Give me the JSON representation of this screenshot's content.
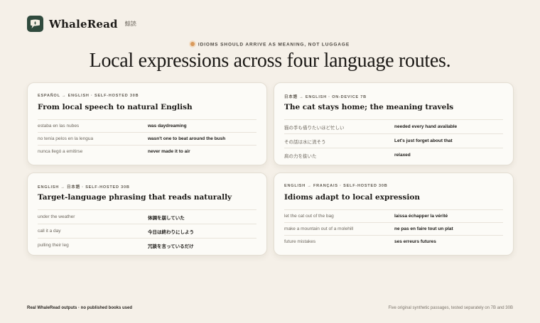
{
  "brand": {
    "name": "WhaleRead",
    "subtitle": "鯨読",
    "logo_icon": "speech-bubble-icon",
    "logo_color": "#2f4a3d"
  },
  "hero": {
    "eyebrow": "IDIOMS SHOULD ARRIVE AS MEANING, NOT LUGGAGE",
    "headline": "Local expressions across four language routes.",
    "accent_color": "#d99a5c"
  },
  "cards": [
    {
      "meta": "ESPAÑOL → ENGLISH · SELF-HOSTED 30B",
      "title": "From local speech to natural English",
      "rows": [
        {
          "source": "estaba en las nubes",
          "target": "was daydreaming"
        },
        {
          "source": "no tenía pelos en la lengua",
          "target": "wasn't one to beat around the bush"
        },
        {
          "source": "nunca llegó a emitirse",
          "target": "never made it to air"
        }
      ]
    },
    {
      "meta": "日本語 → ENGLISH · ON-DEVICE 7B",
      "title": "The cat stays home; the meaning travels",
      "rows": [
        {
          "source": "猫の手も借りたいほど忙しい",
          "target": "needed every hand available"
        },
        {
          "source": "その話は水に流そう",
          "target": "Let's just forget about that"
        },
        {
          "source": "肩の力を抜いた",
          "target": "relaxed"
        }
      ]
    },
    {
      "meta": "ENGLISH → 日本語 · SELF-HOSTED 30B",
      "title": "Target-language phrasing that reads naturally",
      "rows": [
        {
          "source": "under the weather",
          "target": "体調を崩していた"
        },
        {
          "source": "call it a day",
          "target": "今日は終わりにしよう"
        },
        {
          "source": "pulling their leg",
          "target": "冗談を言っているだけ"
        }
      ]
    },
    {
      "meta": "ENGLISH → FRANÇAIS · SELF-HOSTED 30B",
      "title": "Idioms adapt to local expression",
      "rows": [
        {
          "source": "let the cat out of the bag",
          "target": "laissa échapper la vérité"
        },
        {
          "source": "make a mountain out of a molehill",
          "target": "ne pas en faire tout un plat"
        },
        {
          "source": "future mistakes",
          "target": "ses erreurs futures"
        }
      ]
    }
  ],
  "footer": {
    "left": "Real WhaleRead outputs · no published books used",
    "right": "Five original synthetic passages, tested separately on 7B and 30B"
  }
}
